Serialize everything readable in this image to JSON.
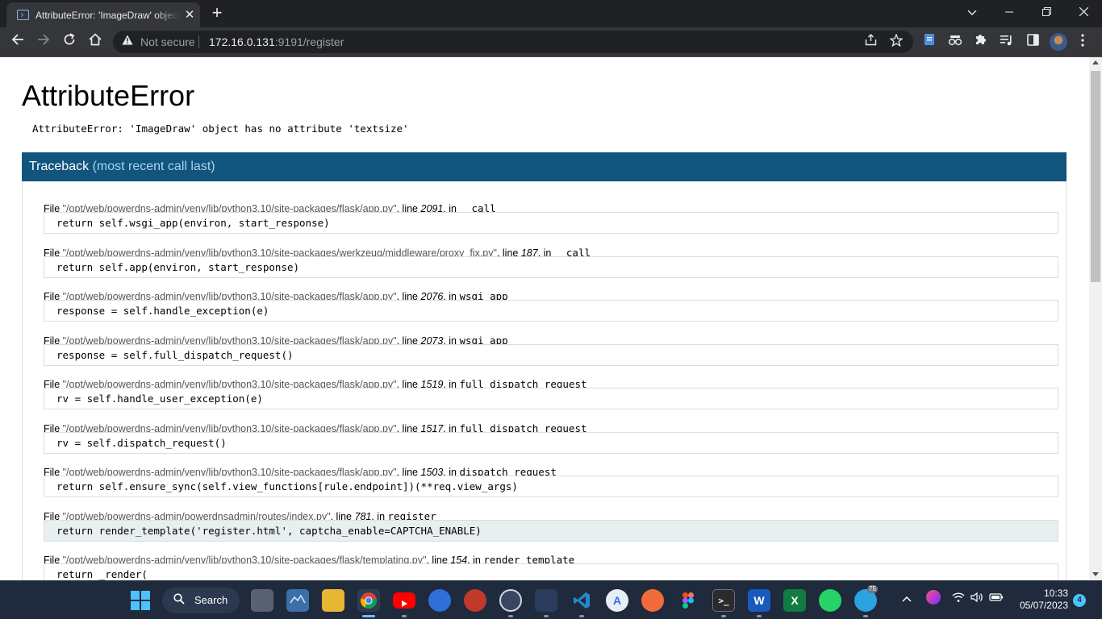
{
  "browser": {
    "tab_title": "AttributeError: 'ImageDraw' object has no attribute 'textsize'",
    "tab_close": "✕",
    "new_tab": "+",
    "window_controls": {
      "minimize": "—",
      "restore": "❐",
      "close": "✕",
      "tab_search": "⌄"
    },
    "not_secure": "Not secure",
    "url_host": "172.16.0.131",
    "url_rest": ":9191/register",
    "icons": [
      "back-icon",
      "forward-icon",
      "reload-icon",
      "home-icon",
      "warning-icon",
      "share-icon",
      "bookmark-star-icon",
      "extension-icons",
      "puzzle-icon",
      "media-icon",
      "sidepanel-icon",
      "profile-avatar",
      "menu-icon"
    ]
  },
  "page": {
    "title": "AttributeError",
    "message": "AttributeError: 'ImageDraw' object has no attribute 'textsize'",
    "traceback_label": "Traceback",
    "traceback_sub": "(most recent call last)",
    "frames": [
      {
        "file": "\"/opt/web/powerdns-admin/venv/lib/python3.10/site-packages/flask/app.py\"",
        "line": "2091",
        "fn": "__call__",
        "code": "return self.wsgi_app(environ, start_response)"
      },
      {
        "file": "\"/opt/web/powerdns-admin/venv/lib/python3.10/site-packages/werkzeug/middleware/proxy_fix.py\"",
        "line": "187",
        "fn": "__call__",
        "code": "return self.app(environ, start_response)"
      },
      {
        "file": "\"/opt/web/powerdns-admin/venv/lib/python3.10/site-packages/flask/app.py\"",
        "line": "2076",
        "fn": "wsgi_app",
        "code": "response = self.handle_exception(e)"
      },
      {
        "file": "\"/opt/web/powerdns-admin/venv/lib/python3.10/site-packages/flask/app.py\"",
        "line": "2073",
        "fn": "wsgi_app",
        "code": "response = self.full_dispatch_request()"
      },
      {
        "file": "\"/opt/web/powerdns-admin/venv/lib/python3.10/site-packages/flask/app.py\"",
        "line": "1519",
        "fn": "full_dispatch_request",
        "code": "rv = self.handle_user_exception(e)"
      },
      {
        "file": "\"/opt/web/powerdns-admin/venv/lib/python3.10/site-packages/flask/app.py\"",
        "line": "1517",
        "fn": "full_dispatch_request",
        "code": "rv = self.dispatch_request()"
      },
      {
        "file": "\"/opt/web/powerdns-admin/venv/lib/python3.10/site-packages/flask/app.py\"",
        "line": "1503",
        "fn": "dispatch_request",
        "code": "return self.ensure_sync(self.view_functions[rule.endpoint])(**req.view_args)"
      },
      {
        "file": "\"/opt/web/powerdns-admin/powerdnsadmin/routes/index.py\"",
        "line": "781",
        "fn": "register",
        "code": "return render_template('register.html', captcha_enable=CAPTCHA_ENABLE)",
        "current": true
      },
      {
        "file": "\"/opt/web/powerdns-admin/venv/lib/python3.10/site-packages/flask/templating.py\"",
        "line": "154",
        "fn": "render_template",
        "code": "return _render("
      }
    ],
    "words": {
      "file": "File ",
      "line": ", line ",
      "in": ", in "
    }
  },
  "taskbar": {
    "search_label": "Search",
    "time": "10:33",
    "date": "05/07/2023",
    "notification_count": "4",
    "telegram_badge": "75",
    "apps": [
      "file-manager-icon",
      "photos-icon",
      "file-explorer-icon",
      "chrome-icon",
      "youtube-icon",
      "app-icon",
      "app-icon",
      "app-icon",
      "app-icon",
      "vscode-icon",
      "app-icon",
      "app-icon",
      "figma-icon",
      "terminal-icon",
      "word-icon",
      "excel-icon",
      "whatsapp-icon",
      "telegram-icon"
    ]
  }
}
